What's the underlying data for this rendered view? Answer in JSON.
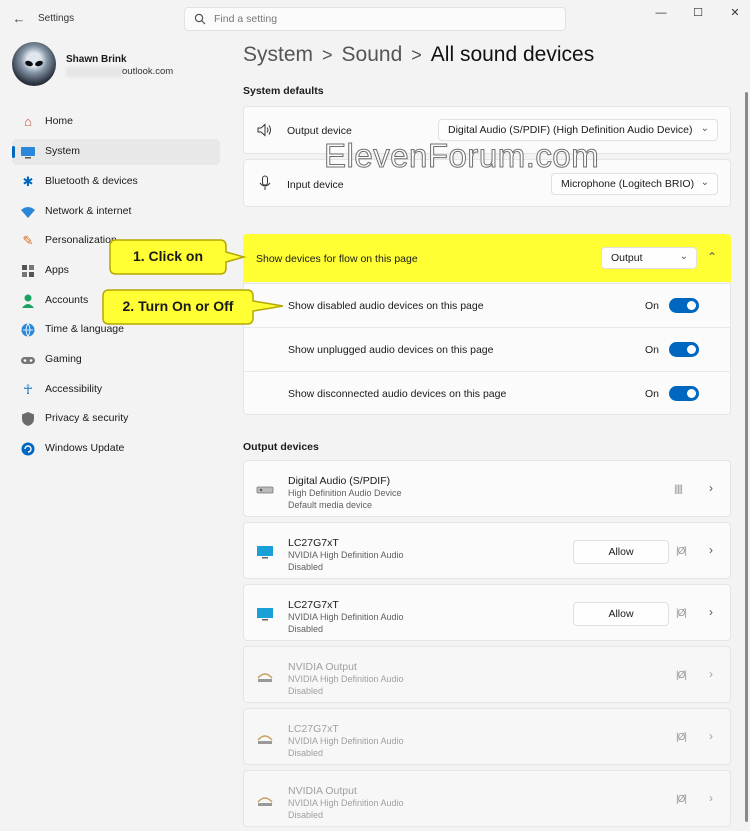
{
  "window": {
    "app_title": "Settings",
    "back_icon": "back-arrow-icon",
    "minimize": "—",
    "maximize": "☐",
    "close": "✕"
  },
  "search": {
    "placeholder": "Find a setting"
  },
  "user": {
    "name": "Shawn Brink",
    "email_suffix": "outlook.com"
  },
  "sidebar": {
    "items": [
      {
        "label": "Home",
        "icon": "home-icon"
      },
      {
        "label": "System",
        "icon": "system-icon",
        "active": true
      },
      {
        "label": "Bluetooth & devices",
        "icon": "bluetooth-icon"
      },
      {
        "label": "Network & internet",
        "icon": "wifi-icon"
      },
      {
        "label": "Personalization",
        "icon": "brush-icon"
      },
      {
        "label": "Apps",
        "icon": "apps-icon"
      },
      {
        "label": "Accounts",
        "icon": "accounts-icon"
      },
      {
        "label": "Time & language",
        "icon": "globe-icon"
      },
      {
        "label": "Gaming",
        "icon": "gamepad-icon"
      },
      {
        "label": "Accessibility",
        "icon": "accessibility-icon"
      },
      {
        "label": "Privacy & security",
        "icon": "shield-icon"
      },
      {
        "label": "Windows Update",
        "icon": "update-icon"
      }
    ]
  },
  "breadcrumb": {
    "items": [
      "System",
      "Sound",
      "All sound devices"
    ],
    "separator": ">"
  },
  "system_defaults": {
    "heading": "System defaults",
    "output": {
      "label": "Output device",
      "value": "Digital Audio (S/PDIF) (High Definition Audio Device)"
    },
    "input": {
      "label": "Input device",
      "value": "Microphone (Logitech BRIO)"
    }
  },
  "watermark": "ElevenForum.com",
  "flow": {
    "label": "Show devices for flow on this page",
    "value": "Output",
    "highlight_color": "#ffff33",
    "options": [
      {
        "label": "Show disabled audio devices on this page",
        "state": "On"
      },
      {
        "label": "Show unplugged audio devices on this page",
        "state": "On"
      },
      {
        "label": "Show disconnected audio devices on this page",
        "state": "On"
      }
    ]
  },
  "callouts": {
    "first": "1. Click on",
    "second": "2. Turn On or Off"
  },
  "output_devices": {
    "heading": "Output devices",
    "allow_label": "Allow",
    "items": [
      {
        "name": "Digital Audio (S/PDIF)",
        "line2": "High Definition Audio Device",
        "line3": "Default media device",
        "icon": "speaker-box-icon"
      },
      {
        "name": "LC27G7xT",
        "line2": "NVIDIA High Definition Audio",
        "line3": "Disabled",
        "icon": "monitor-icon"
      },
      {
        "name": "LC27G7xT",
        "line2": "NVIDIA High Definition Audio",
        "line3": "Disabled",
        "icon": "monitor-icon"
      },
      {
        "name": "NVIDIA Output",
        "line2": "NVIDIA High Definition Audio",
        "line3": "Disabled",
        "icon": "audio-jack-icon"
      },
      {
        "name": "LC27G7xT",
        "line2": "NVIDIA High Definition Audio",
        "line3": "Disabled",
        "icon": "audio-jack-icon"
      },
      {
        "name": "NVIDIA Output",
        "line2": "NVIDIA High Definition Audio",
        "line3": "Disabled",
        "icon": "audio-jack-icon"
      }
    ]
  },
  "colors": {
    "accent": "#0067c0",
    "background": "#f3f3f3"
  }
}
